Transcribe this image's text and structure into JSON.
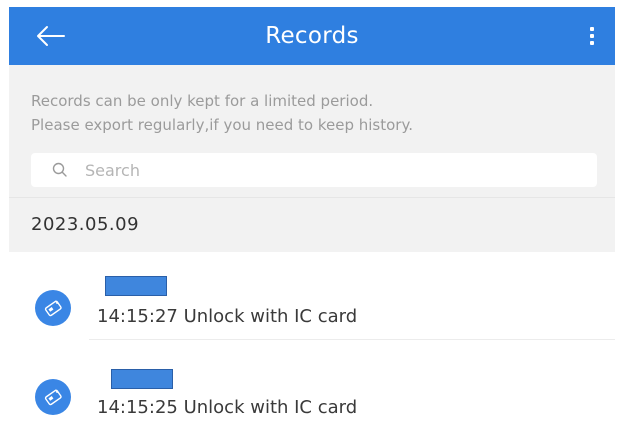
{
  "header": {
    "title": "Records",
    "back_icon": "arrow-left-icon",
    "more_icon": "more-vertical-icon",
    "background_color": "#2f7fe0"
  },
  "notice": {
    "line1": "Records can be only kept for a limited period.",
    "line2": "Please export regularly,if you need to keep history."
  },
  "search": {
    "placeholder": "Search",
    "value": "",
    "icon": "search-icon"
  },
  "date_group": {
    "label": "2023.05.09"
  },
  "records": [
    {
      "name_prefix": "",
      "time": "14:15:27",
      "action": "Unlock with IC card",
      "icon": "ic-card-icon",
      "name_redacted": true
    },
    {
      "name_prefix": "",
      "time": "14:15:25",
      "action": "Unlock with IC card",
      "icon": "ic-card-icon",
      "name_redacted": true
    }
  ],
  "colors": {
    "accent": "#2f7fe0",
    "icon_circle": "#3a86e5",
    "section_bg": "#f2f2f2",
    "notice_text": "#9b9b9b"
  }
}
